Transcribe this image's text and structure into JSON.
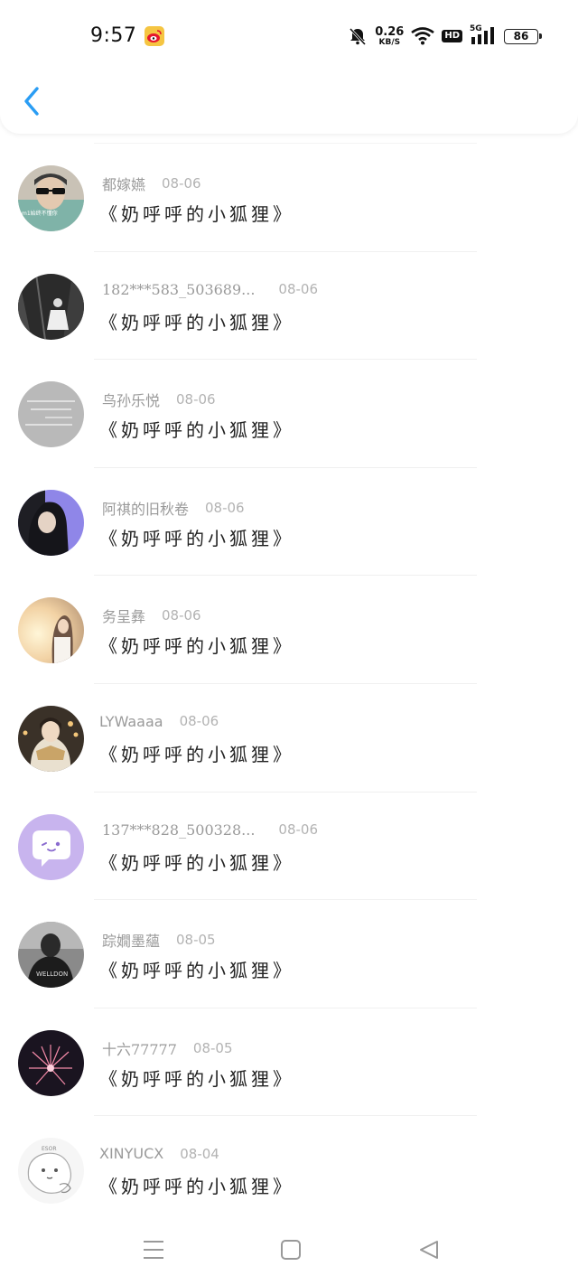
{
  "status_bar": {
    "time": "9:57",
    "net_speed_value": "0.26",
    "net_speed_unit": "KB/S",
    "hd_label": "HD",
    "network_type": "5G",
    "battery": "86"
  },
  "header": {
    "back_icon": "chevron-left-icon",
    "accent_color": "#2a9df4"
  },
  "list": {
    "items": [
      {
        "name": "都嫁嬿",
        "date": "08-06",
        "title": "《奶呼呼的小狐狸》",
        "avatar": "sunglasses-boy"
      },
      {
        "name": "182***583_503689...",
        "date": "08-06",
        "title": "《奶呼呼的小狐狸》",
        "avatar": "girl-forest"
      },
      {
        "name": "鸟孙乐悦",
        "date": "08-06",
        "title": "《奶呼呼的小狐狸》",
        "avatar": "grey-text"
      },
      {
        "name": "阿祺的旧秋卷",
        "date": "08-06",
        "title": "《奶呼呼的小狐狸》",
        "avatar": "hood-girl"
      },
      {
        "name": "务呈彝",
        "date": "08-06",
        "title": "《奶呼呼的小狐狸》",
        "avatar": "sunset-girl"
      },
      {
        "name": "LYWaaaa",
        "date": "08-06",
        "title": "《奶呼呼的小狐狸》",
        "avatar": "scarf-girl"
      },
      {
        "name": "137***828_500328...",
        "date": "08-06",
        "title": "《奶呼呼的小狐狸》",
        "avatar": "purple-chat"
      },
      {
        "name": "踪嫺墨蘊",
        "date": "08-05",
        "title": "《奶呼呼的小狐狸》",
        "avatar": "dark-girl"
      },
      {
        "name": "十六77777",
        "date": "08-05",
        "title": "《奶呼呼的小狐狸》",
        "avatar": "fireworks"
      },
      {
        "name": "XINYUCX",
        "date": "08-04",
        "title": "《奶呼呼的小狐狸》",
        "avatar": "sketch-bear"
      }
    ]
  },
  "navbar": {
    "menu_icon": "menu-icon",
    "home_icon": "home-square-icon",
    "back_icon": "back-triangle-icon"
  }
}
